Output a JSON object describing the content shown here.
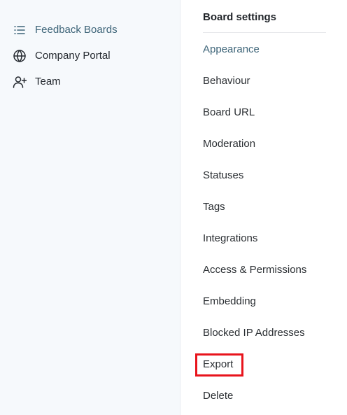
{
  "nav": {
    "items": [
      {
        "label": "Feedback Boards",
        "icon": "list-icon",
        "active": true
      },
      {
        "label": "Company Portal",
        "icon": "globe-icon",
        "active": false
      },
      {
        "label": "Team",
        "icon": "user-plus-icon",
        "active": false
      }
    ]
  },
  "settings": {
    "title": "Board settings",
    "items": [
      {
        "label": "Appearance",
        "active": true
      },
      {
        "label": "Behaviour"
      },
      {
        "label": "Board URL"
      },
      {
        "label": "Moderation"
      },
      {
        "label": "Statuses"
      },
      {
        "label": "Tags"
      },
      {
        "label": "Integrations"
      },
      {
        "label": "Access & Permissions"
      },
      {
        "label": "Embedding"
      },
      {
        "label": "Blocked IP Addresses"
      },
      {
        "label": "Export",
        "highlighted": true
      },
      {
        "label": "Delete"
      }
    ]
  },
  "colors": {
    "accent": "#3d6478",
    "highlight": "#e8141c",
    "sidebar_bg": "#f6f9fc"
  }
}
